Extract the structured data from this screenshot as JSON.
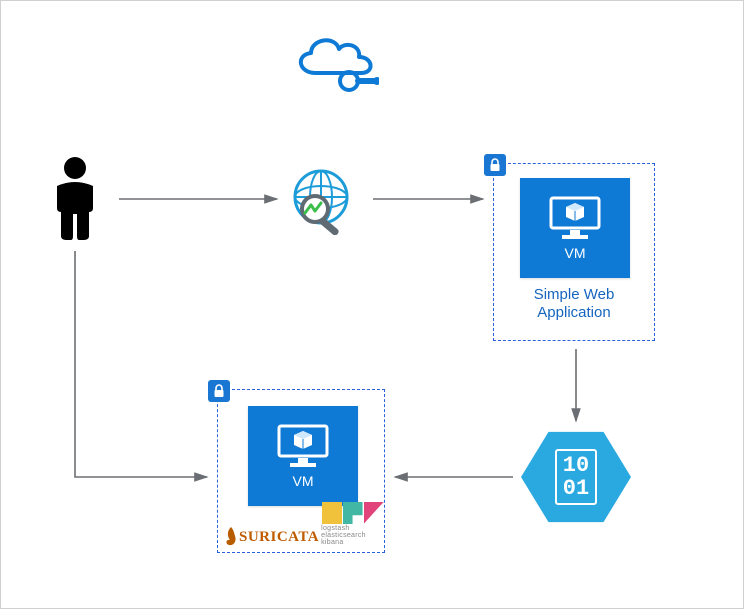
{
  "diagram": {
    "cloud_icon": "azure-cloud-icon",
    "person_icon": "user-icon",
    "globe_search_icon": "network-watcher-icon",
    "webapp_group": {
      "label": "Simple Web\nApplication",
      "vm_label": "VM",
      "lock_icon": "lock-icon"
    },
    "analysis_group": {
      "vm_label": "VM",
      "lock_icon": "lock-icon",
      "suricata_label": "SURICATA",
      "elk_caption": "logstash  elasticsearch  kibana"
    },
    "storage_hex": {
      "line1": "10",
      "line2": "01"
    },
    "colors": {
      "azure_blue": "#0f7ad6",
      "hex_blue": "#29a9e0",
      "dash_blue": "#2962d9",
      "label_blue": "#1565c0"
    }
  }
}
